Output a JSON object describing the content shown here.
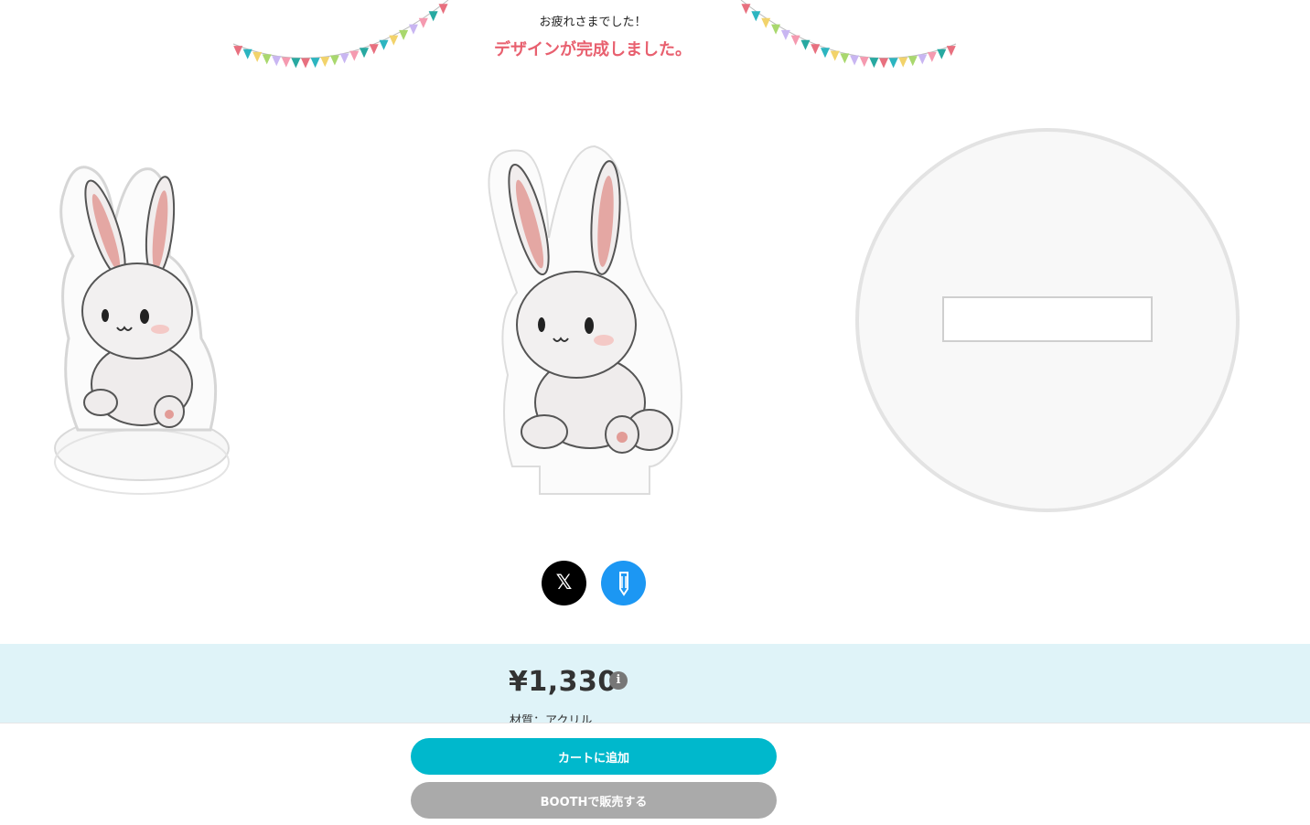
{
  "header": {
    "subtitle": "お疲れさまでした！",
    "title": "デザインが完成しました。"
  },
  "previews": {
    "perspective": "acrylic-stand-3d-preview",
    "front": "acrylic-stand-front-preview",
    "base": "acrylic-stand-base-preview"
  },
  "actions": {
    "share_icon": "x-logo-icon",
    "edit_icon": "pencil-icon"
  },
  "product": {
    "price": "¥1,330",
    "material": "材質：アクリル"
  },
  "footer": {
    "cart_label": "カートに追加",
    "booth_label": "BOOTHで販売する"
  },
  "colors": {
    "accent": "#00b8cc",
    "title": "#e8606f",
    "panel": "#dff3f8",
    "edit": "#1c97f3"
  }
}
